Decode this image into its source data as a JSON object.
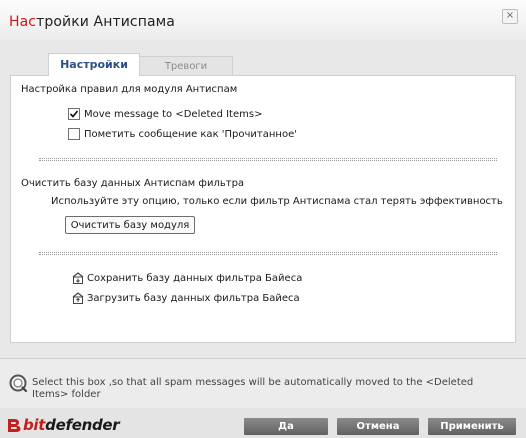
{
  "window": {
    "title_accent": "Нас",
    "title_rest": "тройки Антиспама",
    "close_glyph": "×"
  },
  "tabs": [
    {
      "label": "Настройки",
      "active": true
    },
    {
      "label": "Тревоги",
      "active": false
    }
  ],
  "rules_section": {
    "title": "Настройка правил для модуля Антиспам",
    "options": [
      {
        "label": "Move message to <Deleted Items>",
        "checked": true
      },
      {
        "label": "Пометить сообщение как 'Прочитанное'",
        "checked": false
      }
    ]
  },
  "clear_section": {
    "title": "Очистить базу данных Антиспам фильтра",
    "description": "Используйте эту опцию, только если фильтр Антиспама стал терять эффективность",
    "button_label": "Очистить базу модуля"
  },
  "bayes_links": {
    "save_label": "Сохранить базу данных фильтра Байеса",
    "load_label": "Загрузить базу данных фильтра Байеса"
  },
  "help": {
    "text": "Select this box ,so that all spam messages will be automatically moved to the <Deleted Items> folder"
  },
  "footer": {
    "logo_bit": "bit",
    "logo_defender": "defender",
    "yes_label": "Да",
    "cancel_label": "Отмена",
    "apply_label": "Применить"
  },
  "colors": {
    "accent": "#cc1818",
    "tab_active_text": "#2d4f87",
    "button_bg": "#6e6e6e"
  }
}
